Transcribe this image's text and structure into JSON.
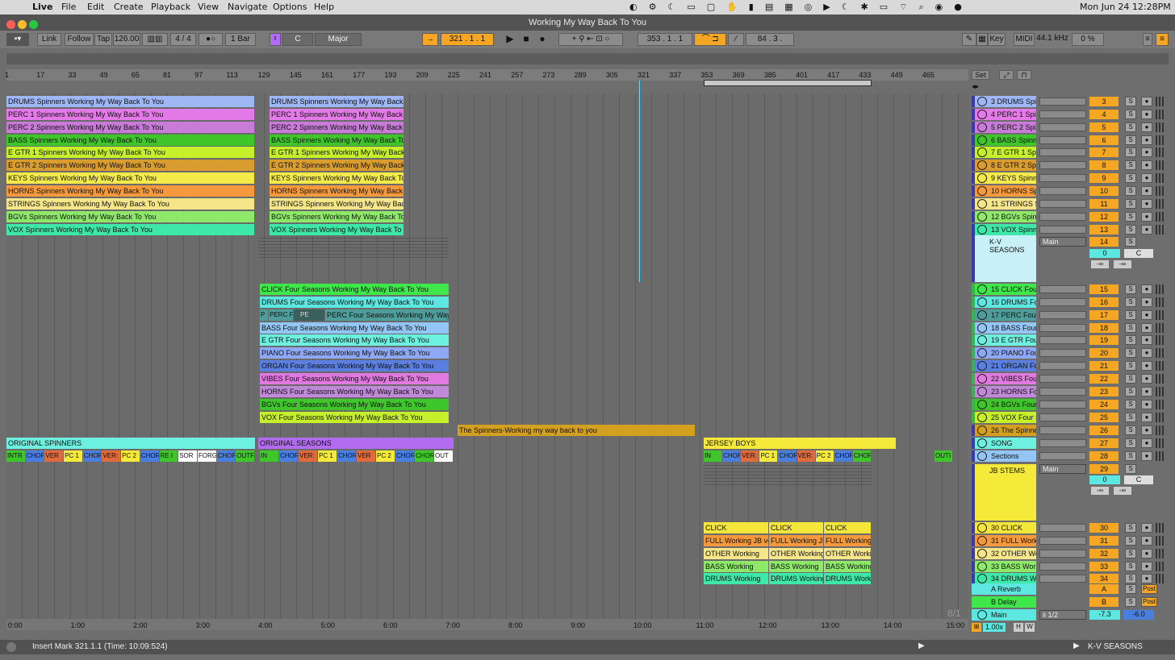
{
  "menubar": {
    "app": "Live",
    "items": [
      "File",
      "Edit",
      "Create",
      "Playback",
      "View",
      "Navigate",
      "Options",
      "Help"
    ],
    "clock": "Mon Jun 24  12:28PM"
  },
  "window": {
    "title": "Working My Way Back To You"
  },
  "control_bar": {
    "link": "Link",
    "follow": "Follow",
    "tap": "Tap",
    "tempo": "126.00",
    "signature": "4 / 4",
    "quantize": "1 Bar",
    "key": "C",
    "scale": "Major",
    "position": "321 .   1 .   1",
    "loop_start": "353 .   1 .   1",
    "loop_length": "84 .   3 .",
    "key_btn": "Key",
    "midi_btn": "MIDI",
    "sample_rate": "44.1 kHz",
    "cpu": "0 %"
  },
  "ruler": {
    "bars": [
      "1",
      "17",
      "33",
      "49",
      "65",
      "81",
      "97",
      "113",
      "129",
      "145",
      "161",
      "177",
      "193",
      "209",
      "225",
      "241",
      "257",
      "273",
      "289",
      "305",
      "321",
      "337",
      "353",
      "369",
      "385",
      "401",
      "417",
      "433",
      "449",
      "465"
    ]
  },
  "set_btn": "Set",
  "spinner_clips": [
    {
      "name": "DRUMS Spinners Working My Way Back To You",
      "color": "#9fb7f5"
    },
    {
      "name": "PERC 1 Spinners Working My Way Back To You",
      "color": "#e47ae7"
    },
    {
      "name": "PERC 2 Spinners Working My Way Back To You",
      "color": "#c97bd8"
    },
    {
      "name": "BASS Spinners Working My Way Back To You",
      "color": "#3fc62a"
    },
    {
      "name": "E GTR 1 Spinners Working My Way Back To You",
      "color": "#c5f02a"
    },
    {
      "name": "E GTR 2 Spinners Working My Way Back To You",
      "color": "#d99c2e"
    },
    {
      "name": "KEYS Spinners Working My Way Back To You",
      "color": "#f4ea4a"
    },
    {
      "name": "HORNS Spinners Working My Way Back To You",
      "color": "#f49a3c"
    },
    {
      "name": "STRINGS Spinners Working My Way Back To You",
      "color": "#f5e68a"
    },
    {
      "name": "BGVs Spinners Working My Way Back To You",
      "color": "#8ee86a"
    },
    {
      "name": "VOX Spinners Working My Way Back To You",
      "color": "#3ee8a8"
    }
  ],
  "spinner_headers": [
    "3 DRUMS Spin",
    "4 PERC 1 Spin",
    "5 PERC 2 Spin",
    "6 BASS Spinn",
    "7 E GTR 1 Spi",
    "8 E GTR 2 Spi",
    "9 KEYS Spinn",
    "10 HORNS Spi",
    "11 STRINGS S",
    "12 BGVs Spin",
    "13 VOX Spinn"
  ],
  "spinner_nums": [
    "3",
    "4",
    "5",
    "6",
    "7",
    "8",
    "9",
    "10",
    "11",
    "12",
    "13"
  ],
  "group_kv": {
    "name": "K-V SEASONS",
    "output": "Main",
    "num": "14",
    "vol": "0",
    "pan": "C",
    "inf1": "-∞",
    "inf2": "-∞"
  },
  "seasons_clips": [
    {
      "name": "CLICK Four Seasons Working My Way Back To You",
      "color": "#3fe84a"
    },
    {
      "name": "DRUMS Four Seasons Working My Way Back To You",
      "color": "#5ce8e0"
    },
    {
      "name": "PERC Four Seasons Working My Way Back To You",
      "color": "#4f9d9a"
    },
    {
      "name": "BASS Four Seasons Working My Way Back To You",
      "color": "#93c5f5"
    },
    {
      "name": "E GTR Four Seasons Working My Way Back To You",
      "color": "#6ef0e0"
    },
    {
      "name": "PIANO Four Seasons Working My Way Back To You",
      "color": "#8fa8f5"
    },
    {
      "name": "ORGAN Four Seasons Working My Way Back To You",
      "color": "#5a7fe0"
    },
    {
      "name": "VIBES Four Seasons Working My Way Back To You",
      "color": "#e07ae0"
    },
    {
      "name": "HORNS Four Seasons Working My Way Back To You",
      "color": "#c08ad8"
    },
    {
      "name": "BGVs Four Seasons Working My Way Back To You",
      "color": "#3fc62a"
    },
    {
      "name": "VOX Four Seasons Working My Way Back To You",
      "color": "#c5f02a"
    }
  ],
  "perc_fragments": {
    "a": "P",
    "b": "PERC F",
    "c": "PE"
  },
  "seasons_headers": [
    "15 CLICK Fou",
    "16 DRUMS Fo",
    "17 PERC Four",
    "18 BASS Four",
    "19 E GTR Four",
    "20 PIANO Fou",
    "21 ORGAN Fo",
    "22 VIBES Four",
    "23 HORNS Fo",
    "24 BGVs Four",
    "25 VOX Four S"
  ],
  "seasons_nums": [
    "15",
    "16",
    "17",
    "18",
    "19",
    "20",
    "21",
    "22",
    "23",
    "24",
    "25"
  ],
  "spinner_audio": {
    "clip": "The Spinners-Working my way back to you",
    "header": "26 The Spinne",
    "num": "26"
  },
  "song": {
    "header": "SONG",
    "num": "27",
    "clips": [
      "ORIGINAL SPINNERS",
      "ORIGINAL SEASONS",
      "JERSEY BOYS"
    ]
  },
  "sections": {
    "header": "Sections",
    "num": "28",
    "a": [
      "INTR",
      "CHORI",
      "VER",
      "PC 1",
      "CHORI",
      "VER:",
      "PC 2",
      "CHORI",
      "RE I",
      "SOR",
      "FORGI",
      "CHORI",
      "OUTF"
    ],
    "b": [
      "IN",
      "CHORI",
      "VER:",
      "PC 1",
      "CHORI",
      "VER",
      "PC 2",
      "CHORI",
      "CHORUS",
      "OUT"
    ],
    "c": [
      "IN",
      "CHORI",
      "VER:",
      "PC 1",
      "CHORI",
      "VER:",
      "PC 2",
      "CHORI",
      "CHOR"
    ],
    "tail": "OUTI"
  },
  "jb_group": {
    "name": "JB STEMS",
    "output": "Main",
    "num": "29",
    "vol": "0",
    "pan": "C",
    "inf1": "-∞",
    "inf2": "-∞"
  },
  "jb_tracks": [
    {
      "header": "30 CLICK",
      "num": "30",
      "clips": [
        "CLICK",
        "CLICK",
        "CLICK"
      ],
      "color": "#f5e63a"
    },
    {
      "header": "31 FULL Work",
      "num": "31",
      "clips": [
        "FULL Working JB ve",
        "FULL Working JB",
        "FULL Working"
      ],
      "color": "#f49a3c"
    },
    {
      "header": "32 OTHER Wo",
      "num": "32",
      "clips": [
        "OTHER Working",
        "OTHER Working",
        "OTHER Workin"
      ],
      "color": "#f5e68a"
    },
    {
      "header": "33 BASS Work",
      "num": "33",
      "clips": [
        "BASS Working",
        "BASS Working",
        "BASS Working"
      ],
      "color": "#8ee86a"
    },
    {
      "header": "34 DRUMS Wo",
      "num": "34",
      "clips": [
        "DRUMS Working",
        "DRUMS Working",
        "DRUMS Worki"
      ],
      "color": "#3ee8a8"
    }
  ],
  "returns": [
    {
      "name": "A Reverb",
      "letter": "A",
      "post": "Post",
      "color": "#5ce8e0"
    },
    {
      "name": "B Delay",
      "letter": "B",
      "post": "Post",
      "color": "#3fe84a"
    }
  ],
  "main": {
    "name": "Main",
    "input": "ii 1/2",
    "vol": "-7.3",
    "vol2": "-6.0",
    "zoom": "1.00x",
    "h": "H",
    "w": "W"
  },
  "signature_marker": "8/1",
  "time_ruler": [
    "0:00",
    "1:00",
    "2:00",
    "3:00",
    "4:00",
    "5:00",
    "6:00",
    "7:00",
    "8:00",
    "9:00",
    "10:00",
    "11:00",
    "12:00",
    "13:00",
    "14:00",
    "15:00"
  ],
  "status": {
    "text": "Insert Mark 321.1.1 (Time: 10:09:524)",
    "track": "K-V SEASONS"
  }
}
